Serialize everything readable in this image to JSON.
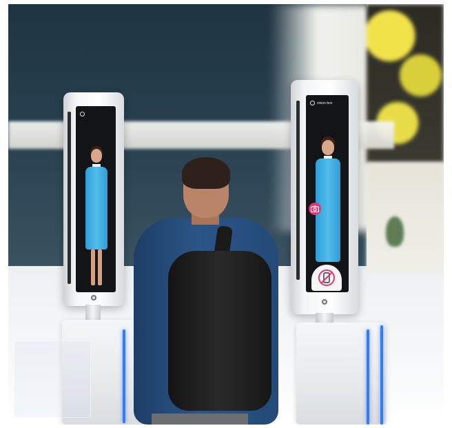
{
  "scene": {
    "description_type": "photo-render",
    "kiosk_left": {
      "brand_label": "",
      "has_avatar": true
    },
    "kiosk_right": {
      "brand_label": "vision-box",
      "has_avatar": true,
      "icons": [
        "camera-icon",
        "no-phone-icon"
      ]
    }
  },
  "colors": {
    "accent_pink": "#e23372",
    "suit_blue": "#53bdeb",
    "gate_glow": "#3a7bea"
  }
}
